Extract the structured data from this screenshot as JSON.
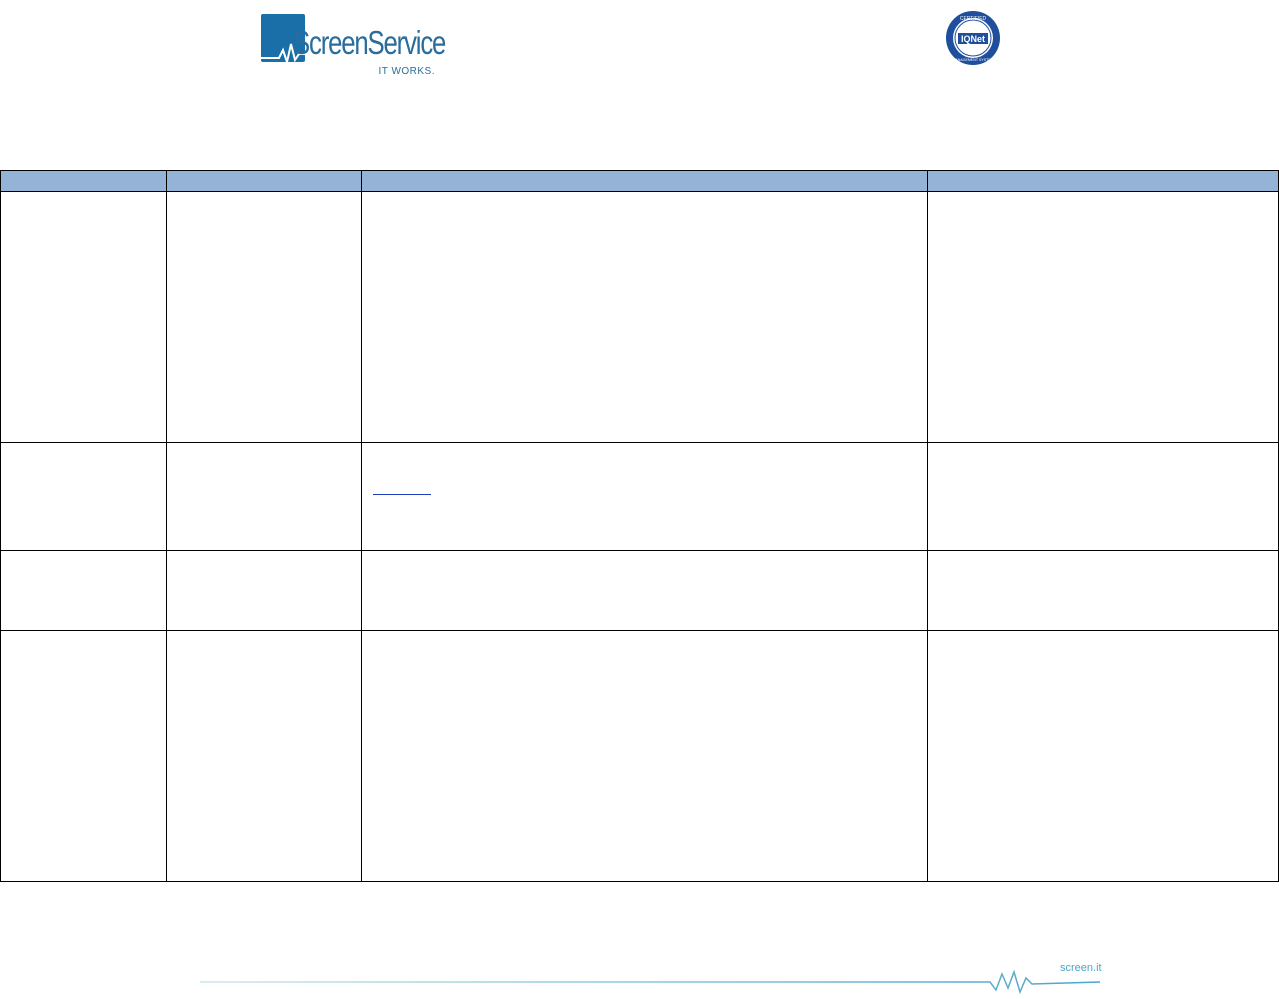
{
  "header": {
    "brand": "ScreenService",
    "tagline": "IT WORKS.",
    "seal_top": "CERTIFIED",
    "seal_name": "IQNet",
    "seal_bottom": "MANAGEMENT SYSTEM"
  },
  "table": {
    "columns": [
      "",
      "",
      "",
      ""
    ],
    "rows": [
      {
        "cells": [
          "",
          "",
          "",
          ""
        ]
      },
      {
        "cells": [
          "",
          "",
          "",
          ""
        ],
        "link": ""
      },
      {
        "cells": [
          "",
          "",
          "",
          ""
        ]
      },
      {
        "cells": [
          "",
          "",
          "",
          ""
        ]
      }
    ]
  },
  "footer": {
    "site": "screen.it"
  },
  "colors": {
    "header_row": "#95b3d7",
    "brand": "#2a6d9c",
    "footer_line": "#4aa6c9"
  }
}
